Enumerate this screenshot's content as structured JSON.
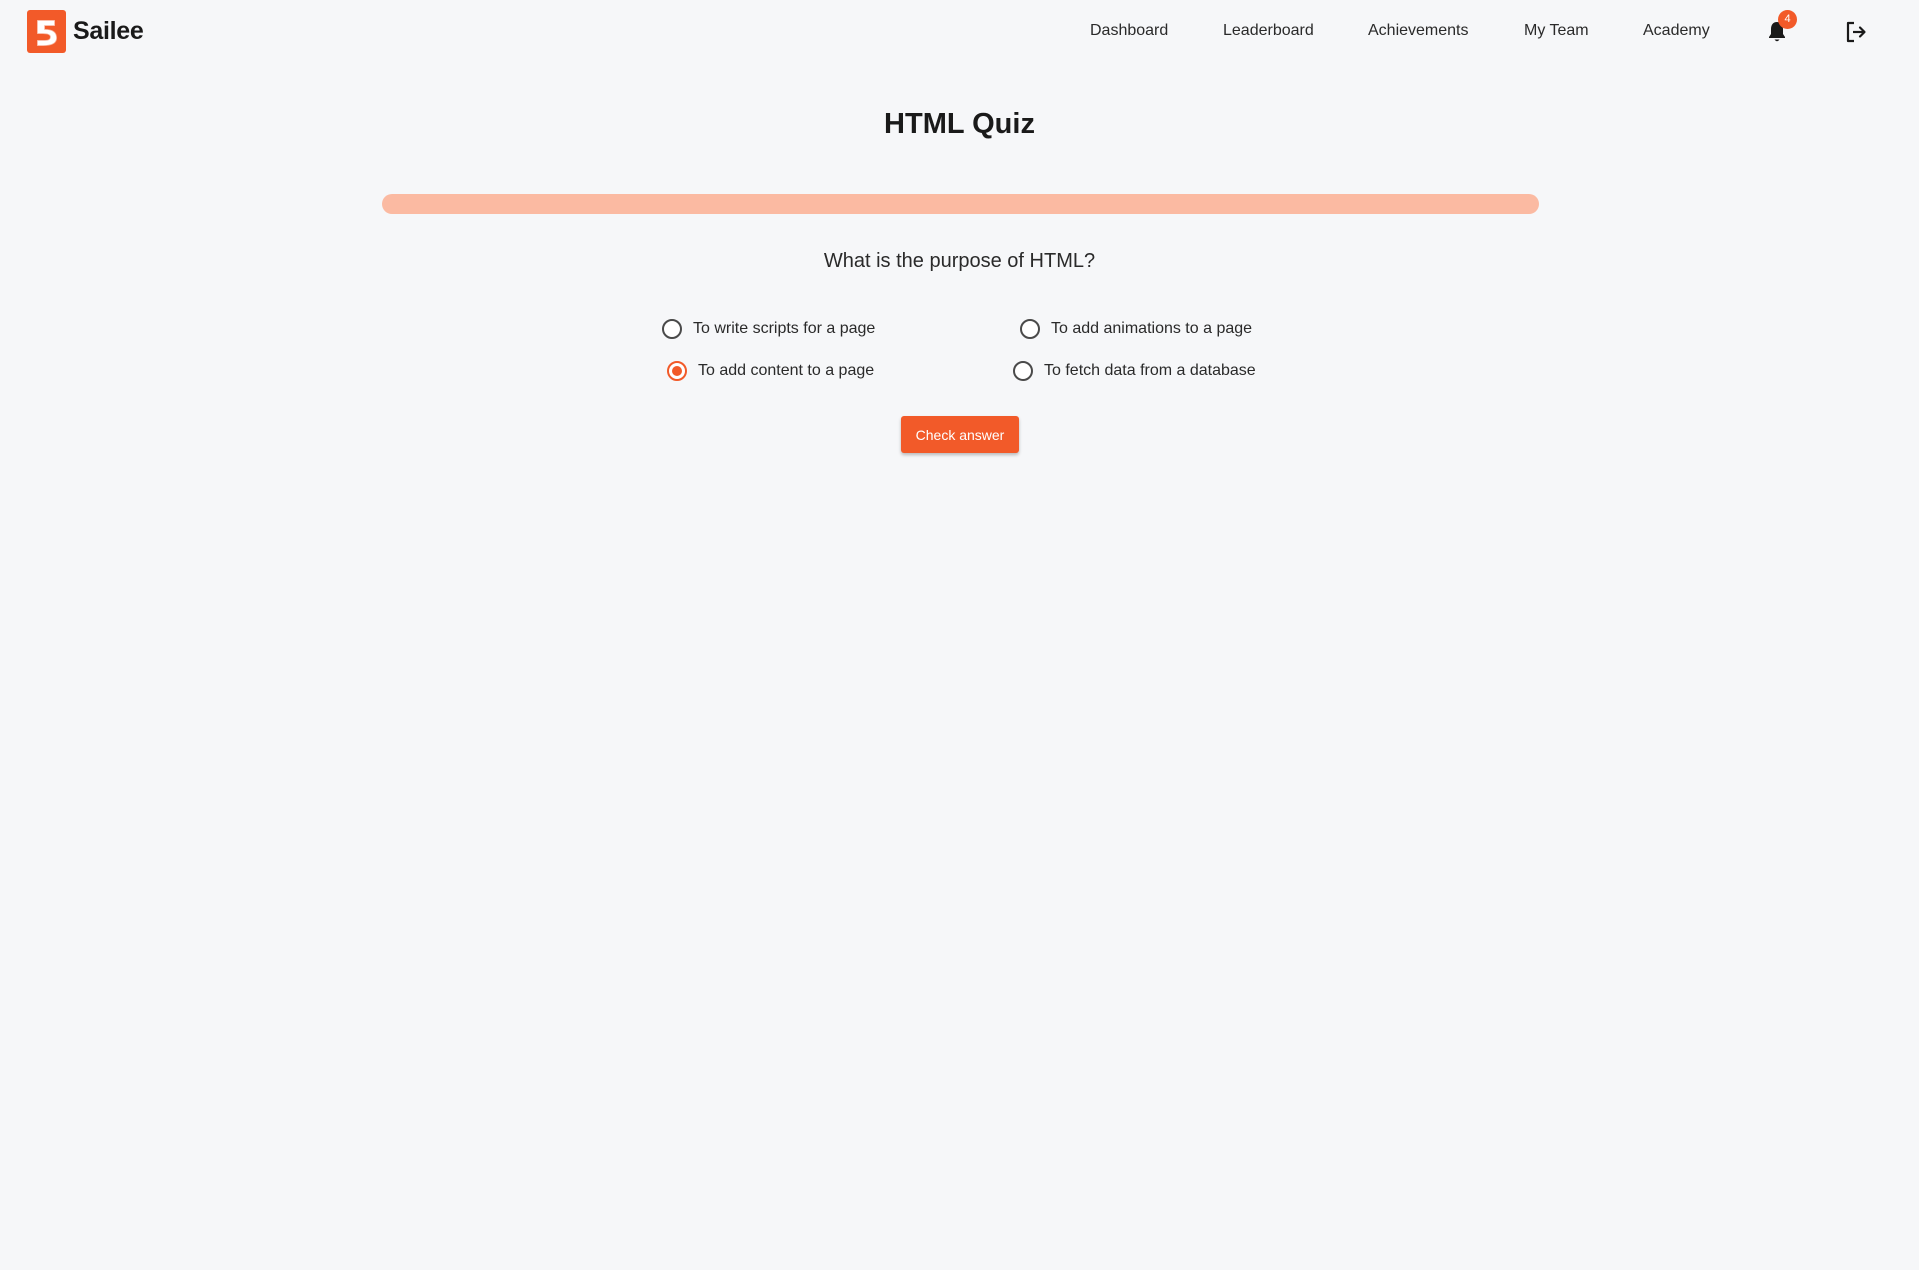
{
  "app": {
    "name": "Sailee",
    "brand_color": "#f25a29"
  },
  "nav": {
    "links": [
      {
        "label": "Dashboard"
      },
      {
        "label": "Leaderboard"
      },
      {
        "label": "Achievements"
      },
      {
        "label": "My Team"
      },
      {
        "label": "Academy"
      }
    ],
    "notification_count": "4",
    "notification_icon": "bell-icon",
    "logout_icon": "logout-icon"
  },
  "quiz": {
    "title": "HTML Quiz",
    "progress": 0,
    "question": "What is the purpose of HTML?",
    "options": [
      {
        "label": "To write scripts for a page",
        "selected": false
      },
      {
        "label": "To add animations to a page",
        "selected": false
      },
      {
        "label": "To add content to a page",
        "selected": true
      },
      {
        "label": "To fetch data from a database",
        "selected": false
      }
    ],
    "check_label": "Check answer"
  }
}
